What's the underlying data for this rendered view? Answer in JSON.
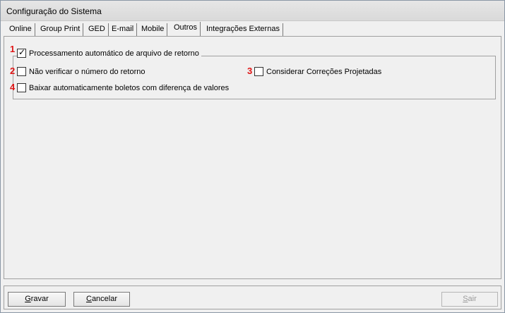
{
  "window": {
    "title": "Configuração do Sistema"
  },
  "tabs": [
    {
      "label": "Online"
    },
    {
      "label": "Group Print"
    },
    {
      "label": "GED"
    },
    {
      "label": "E-mail"
    },
    {
      "label": "Mobile"
    },
    {
      "label": "Outros",
      "active": true
    },
    {
      "label": "Integrações Externas"
    }
  ],
  "options": {
    "auto_process": {
      "marker": "1",
      "label": "Processamento automático de arquivo de retorno",
      "checked": true
    },
    "no_verify_number": {
      "marker": "2",
      "label": "Não verificar o número do retorno",
      "checked": false
    },
    "projected_corrections": {
      "marker": "3",
      "label": "Considerar Correções Projetadas",
      "checked": false
    },
    "auto_download_boletos": {
      "marker": "4",
      "label": "Baixar automaticamente boletos com diferença de valores",
      "checked": false
    }
  },
  "buttons": {
    "save": {
      "label": "Gravar",
      "underline": "G"
    },
    "cancel": {
      "label": "Cancelar",
      "underline": "C"
    },
    "exit": {
      "label": "Sair",
      "underline": "S",
      "disabled": true
    }
  }
}
